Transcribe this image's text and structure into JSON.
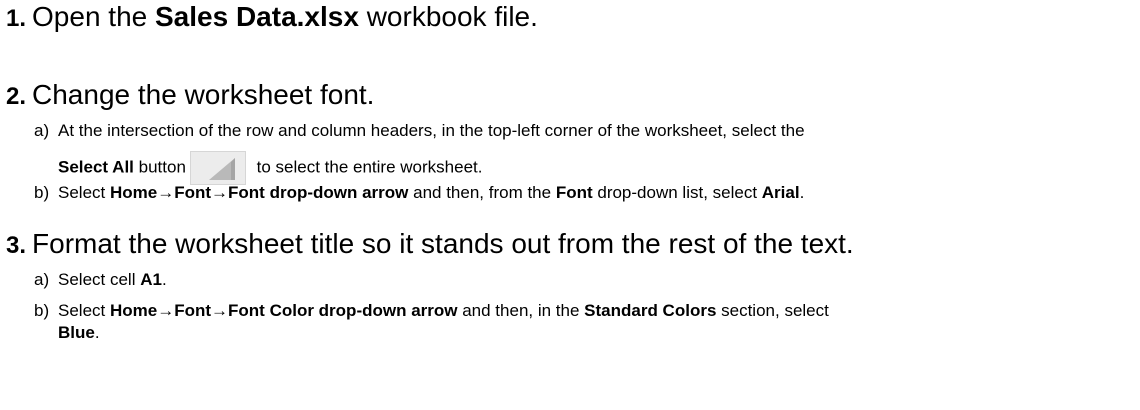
{
  "steps": [
    {
      "num": "1.",
      "pre": "Open the ",
      "bold": "Sales Data.xlsx",
      "post": " workbook file."
    },
    {
      "num": "2.",
      "text": "Change the worksheet font.",
      "subs": [
        {
          "letter": "a)",
          "line1": "At the intersection of the row and column headers, in the top-left corner of the worksheet, select the",
          "line2_bold": "Select All",
          "line2_pre": " button",
          "line2_post": " to select the entire worksheet.",
          "icon": "select-all-button-icon"
        },
        {
          "letter": "b)",
          "t1": "Select ",
          "b1": "Home→Font→Font drop-down arrow",
          "t2": " and then, from the ",
          "b2": "Font",
          "t3": " drop-down list, select ",
          "b3": "Arial",
          "t4": "."
        }
      ]
    },
    {
      "num": "3.",
      "text": "Format the worksheet title so it stands out from the rest of the text.",
      "subs": [
        {
          "letter": "a)",
          "t1": "Select cell ",
          "b1": "A1",
          "t2": "."
        },
        {
          "letter": "b)",
          "t1": "Select ",
          "b1": "Home→Font→Font Color drop-down arrow",
          "t2": " and then, in the ",
          "b2": "Standard Colors",
          "t3": " section, select",
          "line2_bold": "Blue",
          "line2_post": "."
        }
      ]
    }
  ]
}
